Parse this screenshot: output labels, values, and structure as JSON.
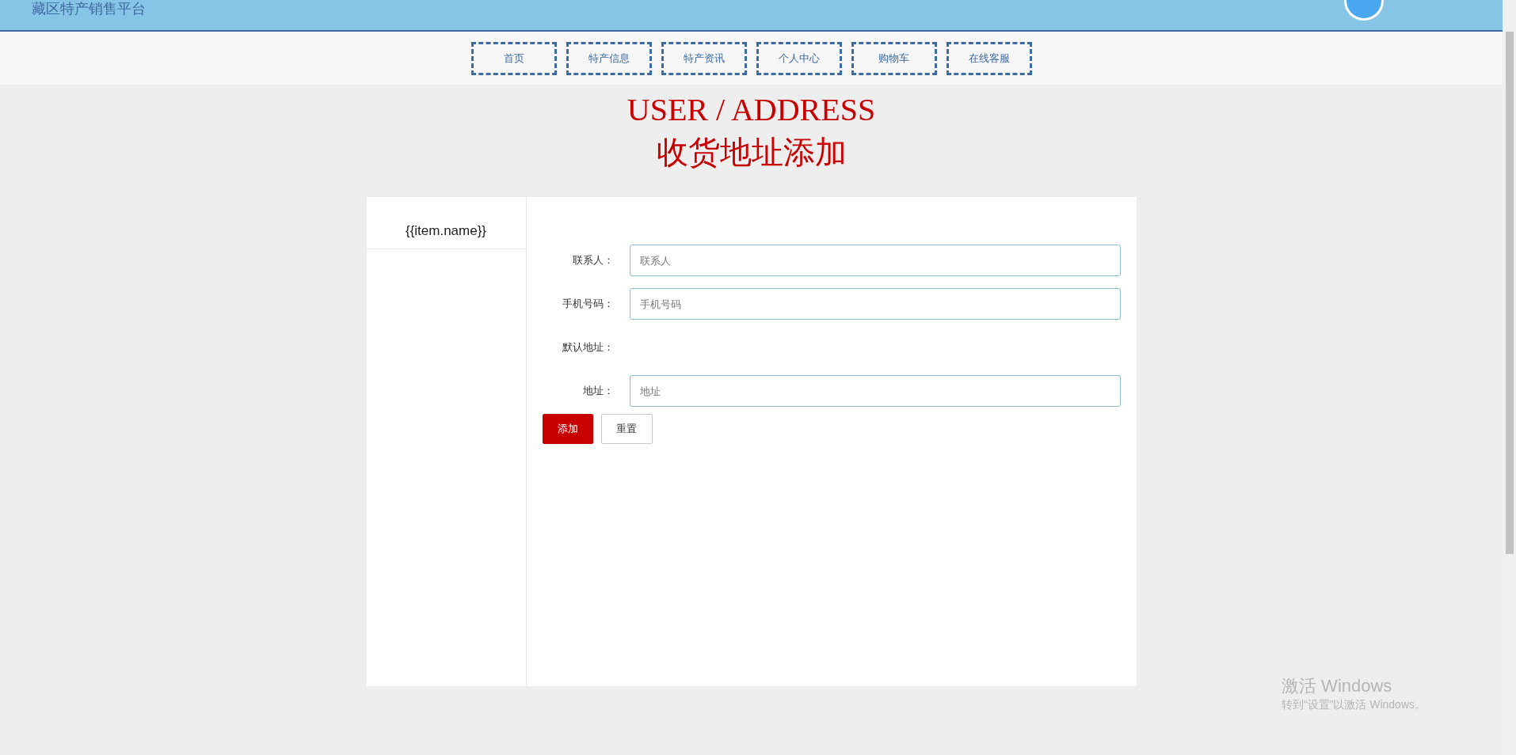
{
  "header": {
    "title": "藏区特产销售平台"
  },
  "nav": [
    {
      "label": "首页"
    },
    {
      "label": "特产信息"
    },
    {
      "label": "特产资讯"
    },
    {
      "label": "个人中心"
    },
    {
      "label": "购物车"
    },
    {
      "label": "在线客服"
    }
  ],
  "heading": {
    "english": "USER / ADDRESS",
    "chinese": "收货地址添加"
  },
  "sidebar": {
    "items": [
      {
        "label": "{{item.name}}"
      }
    ]
  },
  "form": {
    "fields": [
      {
        "kind": "input",
        "label": "联系人：",
        "placeholder": "联系人"
      },
      {
        "kind": "input",
        "label": "手机号码：",
        "placeholder": "手机号码"
      },
      {
        "kind": "label",
        "label": "默认地址："
      },
      {
        "kind": "input",
        "label": "地址：",
        "placeholder": "地址"
      }
    ],
    "buttons": [
      {
        "kind": "primary",
        "label": "添加"
      },
      {
        "kind": "secondary",
        "label": "重置"
      }
    ]
  },
  "activation": {
    "title": "激活 Windows",
    "message": "转到“设置”以激活 Windows。"
  }
}
